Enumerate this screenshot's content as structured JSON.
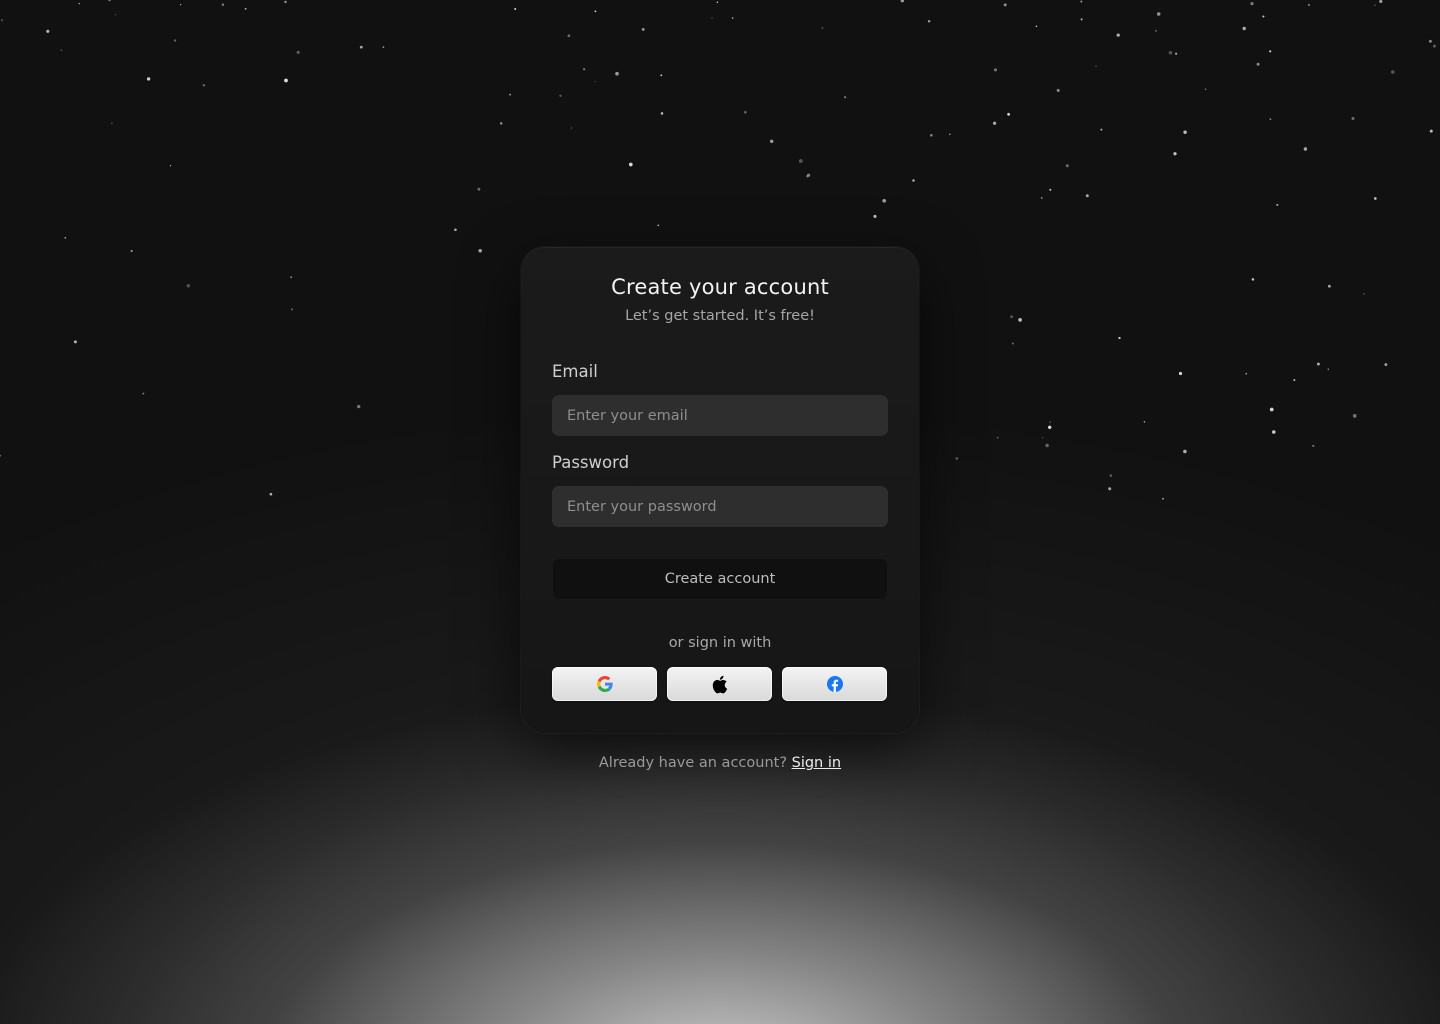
{
  "header": {
    "title": "Create your account",
    "subtitle": "Let’s get started. It’s free!"
  },
  "form": {
    "email_label": "Email",
    "email_placeholder": "Enter your email",
    "email_value": "",
    "password_label": "Password",
    "password_placeholder": "Enter your password",
    "password_value": "",
    "submit_label": "Create account"
  },
  "social": {
    "divider_text": "or sign in with",
    "providers": [
      {
        "name": "google",
        "icon": "google-icon"
      },
      {
        "name": "apple",
        "icon": "apple-icon"
      },
      {
        "name": "facebook",
        "icon": "facebook-icon"
      }
    ]
  },
  "footer": {
    "prompt": "Already have an account?",
    "link_label": "Sign in"
  },
  "colors": {
    "card_background": "#1b1b1b",
    "input_background": "#2e2e2e",
    "button_background": "#101010",
    "facebook_blue": "#1877F2"
  }
}
